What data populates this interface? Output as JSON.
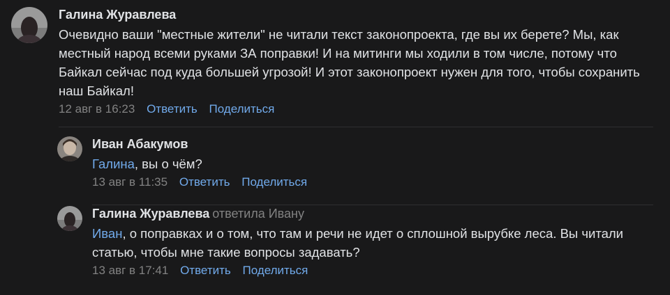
{
  "comments": [
    {
      "author": "Галина Журавлева",
      "text": "Очевидно ваши \"местные жители\" не читали текст законопроекта, где вы их берете? Мы, как местный народ всеми руками ЗА поправки! И на митинги мы ходили в том числе, потому что Байкал сейчас под куда большей угрозой! И этот законопроект нужен для того, чтобы сохранить наш Байкал!",
      "date": "12 авг в 16:23",
      "reply_label": "Ответить",
      "share_label": "Поделиться"
    },
    {
      "author": "Иван Абакумов",
      "mention": "Галина",
      "text": ", вы о чём?",
      "date": "13 авг в 11:35",
      "reply_label": "Ответить",
      "share_label": "Поделиться"
    },
    {
      "author": "Галина Журавлева",
      "replied_to": "ответила Ивану",
      "mention": "Иван",
      "text": ", о поправках и о том, что там и речи не идет о сплошной вырубке леса. Вы читали статью, чтобы мне такие вопросы задавать?",
      "date": "13 авг в 17:41",
      "reply_label": "Ответить",
      "share_label": "Поделиться"
    }
  ],
  "colors": {
    "background": "#19191a",
    "text": "#e1e3e6",
    "secondary": "#828282",
    "link": "#71aaeb"
  }
}
